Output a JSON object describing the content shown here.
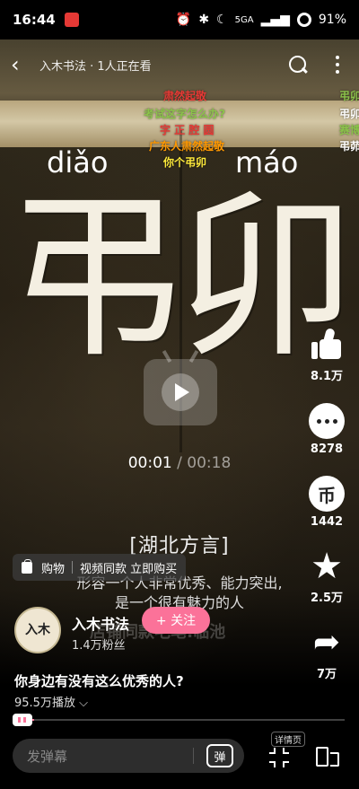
{
  "status_bar": {
    "time": "16:44",
    "network": "5GA",
    "battery": "91%"
  },
  "top_nav": {
    "live_viewers": "入木书法 · 1人正在看"
  },
  "danmaku": [
    {
      "text": "肃然起敬",
      "color": "#e53935"
    },
    {
      "text": "考试这字怎么办?",
      "color": "#8bc34a"
    },
    {
      "text": "字 正 腔 圆",
      "color": "#e53935"
    },
    {
      "text": "广东人肃然起敬",
      "color": "#ff9800"
    },
    {
      "text": "你个弔卯",
      "color": "#ffeb3b"
    },
    {
      "text": "弔卯",
      "color": "#8bc34a"
    },
    {
      "text": "弔卯",
      "color": "#ffffff"
    },
    {
      "text": "赛博",
      "color": "#8bc34a"
    },
    {
      "text": "弔茆",
      "color": "#ffffff"
    }
  ],
  "video": {
    "pinyin_left": "diǎo",
    "pinyin_right": "máo",
    "char_left": "弔",
    "char_right": "卯",
    "time_current": "00:01",
    "time_separator": "/",
    "time_total": "00:18",
    "dialect": "[湖北方言]",
    "subtitle_1": "形容一个人非常优秀、能力突出,",
    "subtitle_2": "是一个很有魅力的人",
    "faded_text": "店铺同款毛笔:临池"
  },
  "shop_chip": {
    "label": "购物",
    "promo": "视频同款 立即购买"
  },
  "actions": {
    "like": "8.1万",
    "comment": "8278",
    "coin": "1442",
    "coin_glyph": "币",
    "favorite": "2.5万",
    "share": "7万"
  },
  "author": {
    "avatar_text": "入木",
    "name": "入木书法",
    "follow_label": "+ 关注",
    "fans": "1.4万粉丝"
  },
  "title": "你身边有没有这么优秀的人?",
  "play_count": "95.5万播放",
  "progress": {
    "fraction": 0.06
  },
  "bottom_bar": {
    "danmaku_placeholder": "发弹幕",
    "danmaku_toggle": "弹",
    "detail_label": "详情页"
  },
  "colors": {
    "accent_pink": "#fb7299"
  }
}
